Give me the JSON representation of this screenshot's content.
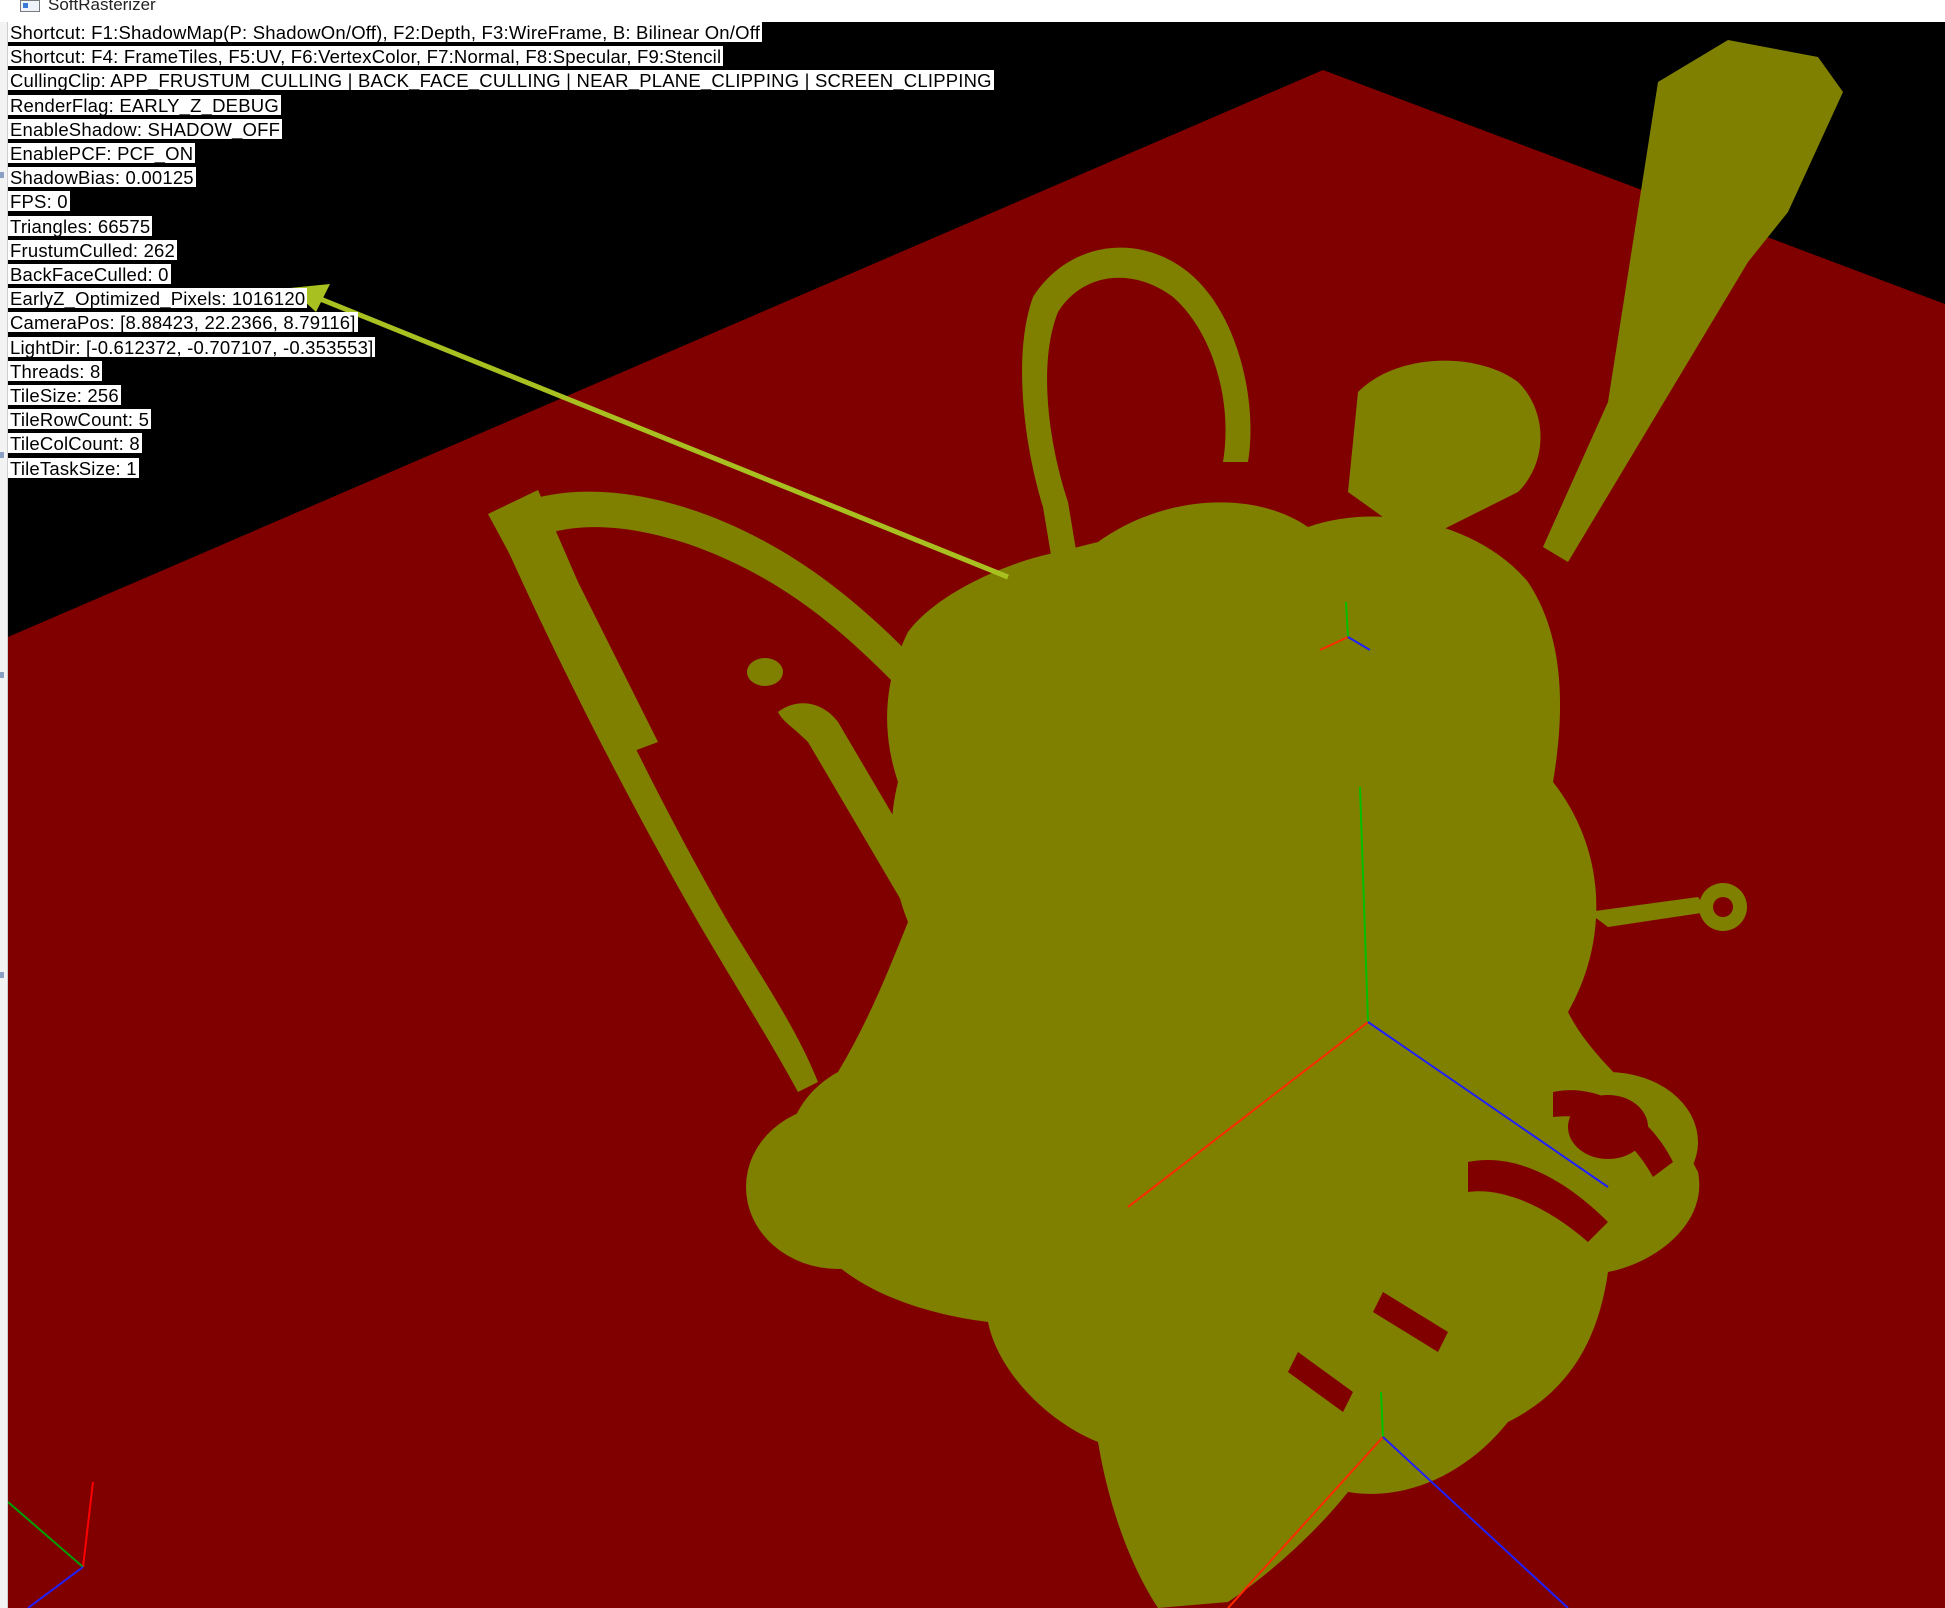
{
  "window": {
    "title": "SoftRasterizer"
  },
  "overlay": {
    "lines": [
      "Shortcut: F1:ShadowMap(P: ShadowOn/Off), F2:Depth, F3:WireFrame, B: Bilinear On/Off",
      "Shortcut: F4: FrameTiles, F5:UV, F6:VertexColor, F7:Normal, F8:Specular, F9:Stencil",
      "CullingClip: APP_FRUSTUM_CULLING | BACK_FACE_CULLING | NEAR_PLANE_CLIPPING | SCREEN_CLIPPING",
      "RenderFlag: EARLY_Z_DEBUG",
      "EnableShadow: SHADOW_OFF",
      "EnablePCF: PCF_ON",
      "ShadowBias: 0.00125",
      "FPS: 0",
      "Triangles: 66575",
      "FrustumCulled: 262",
      "BackFaceCulled: 0",
      "EarlyZ_Optimized_Pixels: 1016120",
      "CameraPos: [8.88423, 22.2366, 8.79116]",
      "LightDir: [-0.612372, -0.707107, -0.353553]",
      "Threads: 8",
      "TileSize: 256",
      "TileRowCount: 5",
      "TileColCount: 8",
      "TileTaskSize: 1"
    ]
  },
  "colors": {
    "background": "#000000",
    "ground_plane": "#800000",
    "early_z_highlight": "#808000",
    "annotation_arrow": "#a8c020",
    "axis_x": "#ff0000",
    "axis_y": "#00c000",
    "axis_z": "#2020ff"
  },
  "icons": [
    "window-app-icon",
    "annotation-arrow-icon"
  ]
}
